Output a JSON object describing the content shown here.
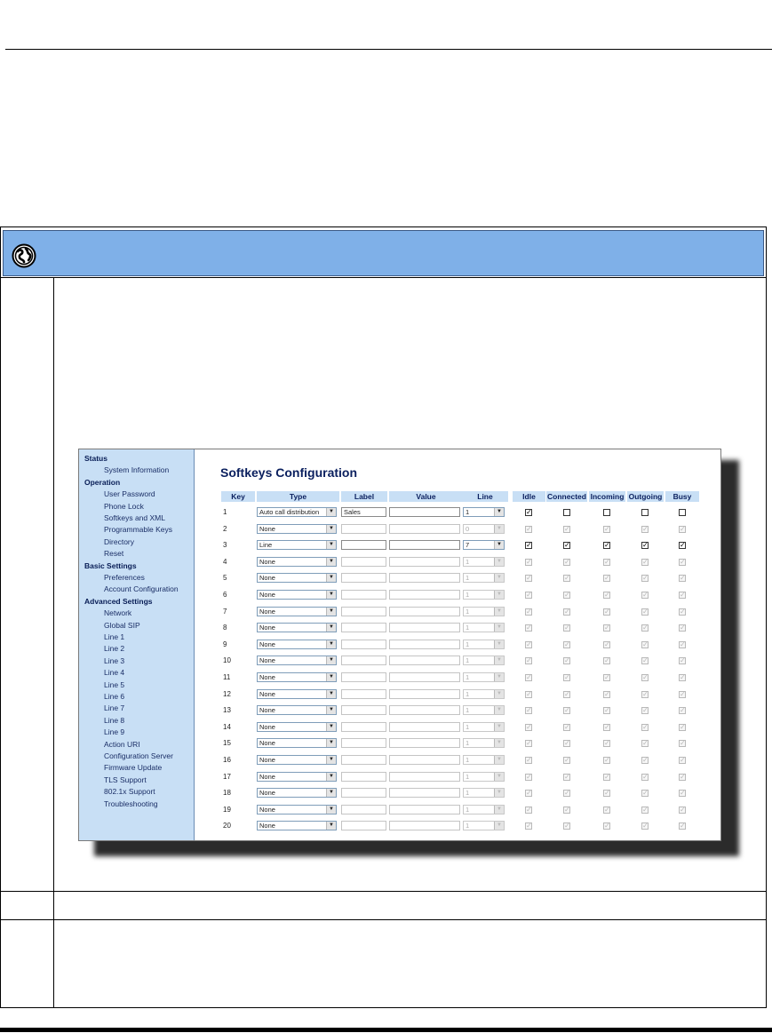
{
  "nav": {
    "sections": [
      {
        "heading": "Status",
        "items": [
          "System Information"
        ]
      },
      {
        "heading": "Operation",
        "items": [
          "User Password",
          "Phone Lock",
          "Softkeys and XML",
          "Programmable Keys",
          "Directory",
          "Reset"
        ]
      },
      {
        "heading": "Basic Settings",
        "items": [
          "Preferences",
          "Account Configuration"
        ]
      },
      {
        "heading": "Advanced Settings",
        "items": [
          "Network",
          "Global SIP",
          "Line 1",
          "Line 2",
          "Line 3",
          "Line 4",
          "Line 5",
          "Line 6",
          "Line 7",
          "Line 8",
          "Line 9",
          "Action URI",
          "Configuration Server",
          "Firmware Update",
          "TLS Support",
          "802.1x Support",
          "Troubleshooting"
        ]
      }
    ]
  },
  "page_title": "Softkeys Configuration",
  "columns": [
    "Key",
    "Type",
    "Label",
    "Value",
    "Line",
    "Idle",
    "Connected",
    "Incoming",
    "Outgoing",
    "Busy"
  ],
  "rows": [
    {
      "key": "1",
      "type": "Auto call distribution",
      "label": "Sales",
      "value": "",
      "line": "1",
      "enabled": true,
      "checks": [
        true,
        false,
        false,
        false,
        false
      ]
    },
    {
      "key": "2",
      "type": "None",
      "label": "",
      "value": "",
      "line": "0",
      "enabled": false,
      "checks": [
        false,
        false,
        false,
        false,
        false
      ]
    },
    {
      "key": "3",
      "type": "Line",
      "label": "",
      "value": "",
      "line": "7",
      "enabled": true,
      "checks": [
        true,
        true,
        true,
        true,
        true
      ]
    },
    {
      "key": "4",
      "type": "None",
      "label": "",
      "value": "",
      "line": "1",
      "enabled": false,
      "checks": [
        false,
        false,
        false,
        false,
        false
      ]
    },
    {
      "key": "5",
      "type": "None",
      "label": "",
      "value": "",
      "line": "1",
      "enabled": false,
      "checks": [
        false,
        false,
        false,
        false,
        false
      ]
    },
    {
      "key": "6",
      "type": "None",
      "label": "",
      "value": "",
      "line": "1",
      "enabled": false,
      "checks": [
        false,
        false,
        false,
        false,
        false
      ]
    },
    {
      "key": "7",
      "type": "None",
      "label": "",
      "value": "",
      "line": "1",
      "enabled": false,
      "checks": [
        false,
        false,
        false,
        false,
        false
      ]
    },
    {
      "key": "8",
      "type": "None",
      "label": "",
      "value": "",
      "line": "1",
      "enabled": false,
      "checks": [
        false,
        false,
        false,
        false,
        false
      ]
    },
    {
      "key": "9",
      "type": "None",
      "label": "",
      "value": "",
      "line": "1",
      "enabled": false,
      "checks": [
        false,
        false,
        false,
        false,
        false
      ]
    },
    {
      "key": "10",
      "type": "None",
      "label": "",
      "value": "",
      "line": "1",
      "enabled": false,
      "checks": [
        false,
        false,
        false,
        false,
        false
      ]
    },
    {
      "key": "11",
      "type": "None",
      "label": "",
      "value": "",
      "line": "1",
      "enabled": false,
      "checks": [
        false,
        false,
        false,
        false,
        false
      ]
    },
    {
      "key": "12",
      "type": "None",
      "label": "",
      "value": "",
      "line": "1",
      "enabled": false,
      "checks": [
        false,
        false,
        false,
        false,
        false
      ]
    },
    {
      "key": "13",
      "type": "None",
      "label": "",
      "value": "",
      "line": "1",
      "enabled": false,
      "checks": [
        false,
        false,
        false,
        false,
        false
      ]
    },
    {
      "key": "14",
      "type": "None",
      "label": "",
      "value": "",
      "line": "1",
      "enabled": false,
      "checks": [
        false,
        false,
        false,
        false,
        false
      ]
    },
    {
      "key": "15",
      "type": "None",
      "label": "",
      "value": "",
      "line": "1",
      "enabled": false,
      "checks": [
        false,
        false,
        false,
        false,
        false
      ]
    },
    {
      "key": "16",
      "type": "None",
      "label": "",
      "value": "",
      "line": "1",
      "enabled": false,
      "checks": [
        false,
        false,
        false,
        false,
        false
      ]
    },
    {
      "key": "17",
      "type": "None",
      "label": "",
      "value": "",
      "line": "1",
      "enabled": false,
      "checks": [
        false,
        false,
        false,
        false,
        false
      ]
    },
    {
      "key": "18",
      "type": "None",
      "label": "",
      "value": "",
      "line": "1",
      "enabled": false,
      "checks": [
        false,
        false,
        false,
        false,
        false
      ]
    },
    {
      "key": "19",
      "type": "None",
      "label": "",
      "value": "",
      "line": "1",
      "enabled": false,
      "checks": [
        false,
        false,
        false,
        false,
        false
      ]
    },
    {
      "key": "20",
      "type": "None",
      "label": "",
      "value": "",
      "line": "1",
      "enabled": false,
      "checks": [
        false,
        false,
        false,
        false,
        false
      ]
    }
  ],
  "colors": {
    "banner": "#7fb0e8",
    "nav_bg": "#c8dff5",
    "header_text": "#0a1f5e"
  },
  "icons": {
    "banner": "globe-icon"
  }
}
